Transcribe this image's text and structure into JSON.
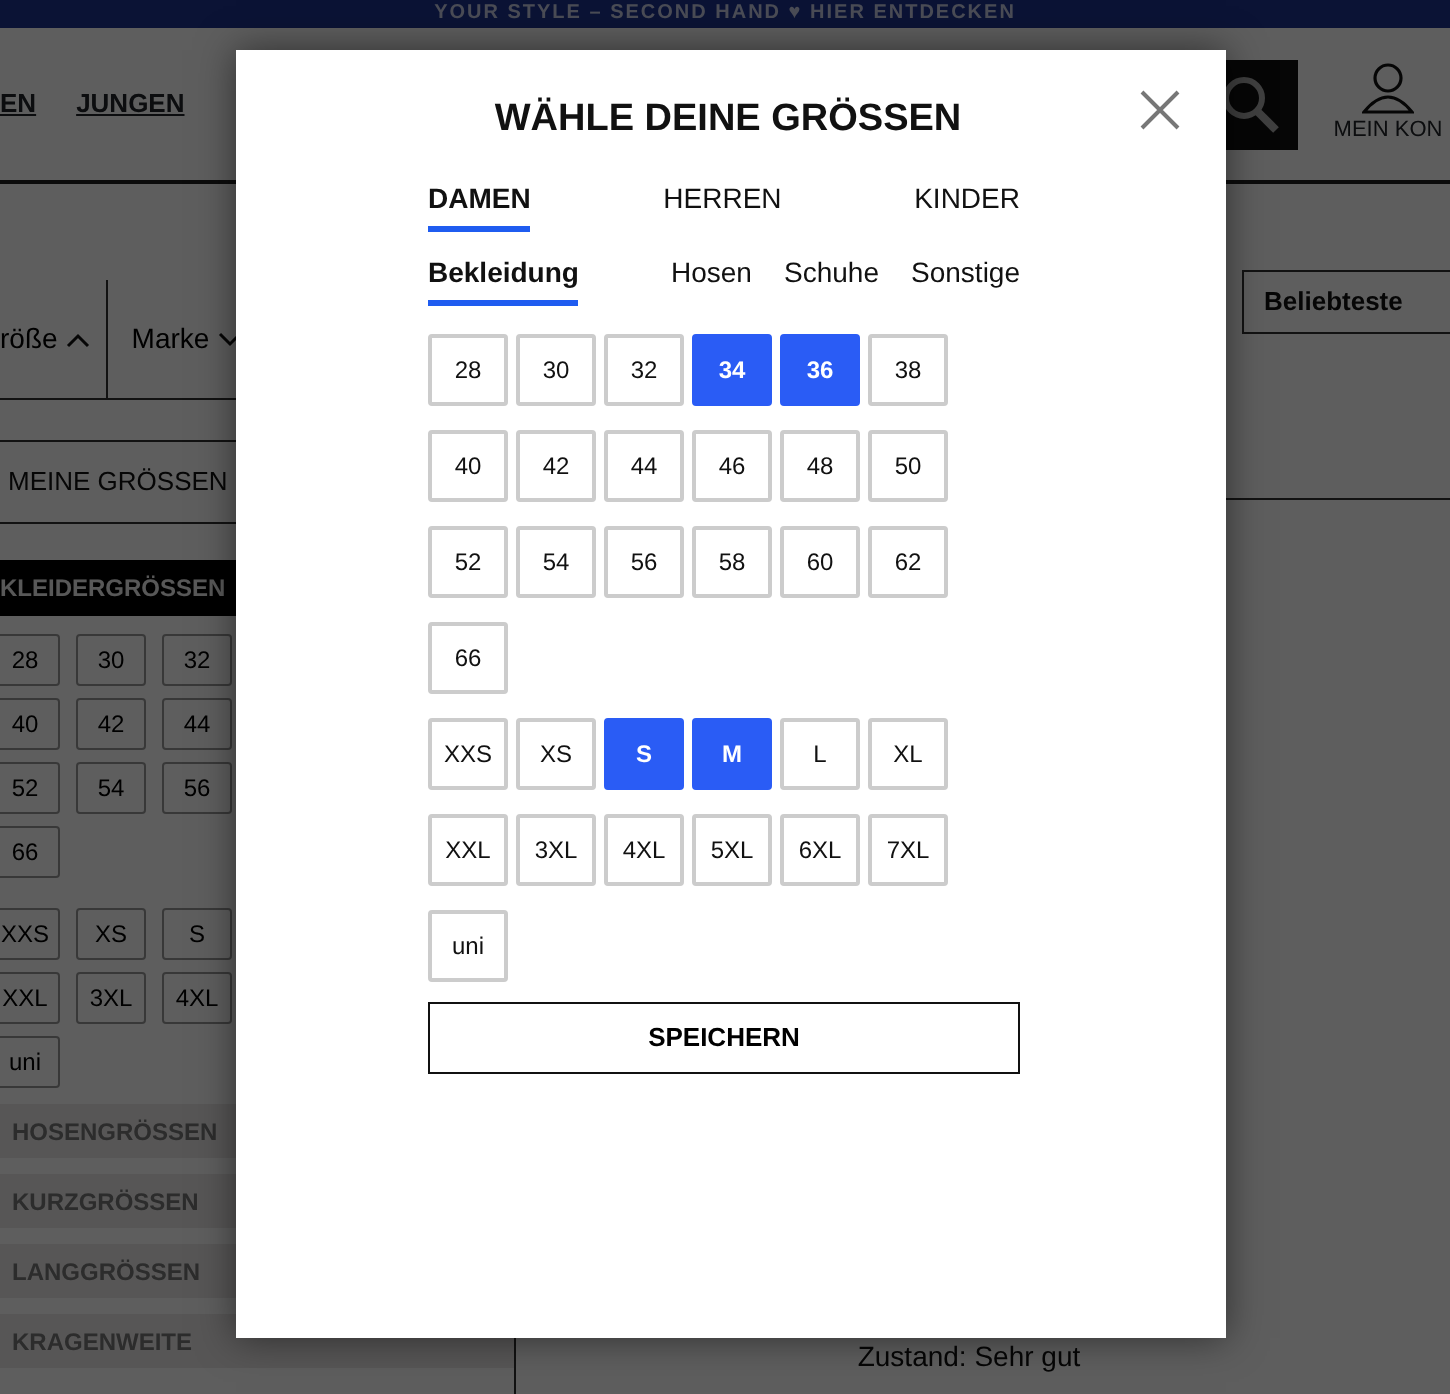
{
  "banner": {
    "text": "YOUR STYLE – SECOND HAND ♥ HIER ENTDECKEN"
  },
  "nav": [
    {
      "label": "EN"
    },
    {
      "label": "JUNGEN"
    }
  ],
  "account": {
    "label": "MEIN KON"
  },
  "filters": [
    {
      "label": "röße",
      "expanded": true
    },
    {
      "label": "Marke",
      "expanded": false
    }
  ],
  "sort": {
    "label": "Beliebteste"
  },
  "sidebar": {
    "title": "MEINE GRÖSSEN",
    "groups": [
      {
        "title": "KLEIDERGRÖSSEN",
        "expanded": true,
        "sizes": [
          [
            "28",
            "30",
            "32"
          ],
          [
            "40",
            "42",
            "44"
          ],
          [
            "52",
            "54",
            "56"
          ],
          [
            "66"
          ],
          [
            "XXS",
            "XS",
            "S"
          ],
          [
            "XXL",
            "3XL",
            "4XL"
          ],
          [
            "uni"
          ]
        ]
      },
      {
        "title": "HOSENGRÖSSEN",
        "expanded": false
      },
      {
        "title": "KURZGRÖSSEN",
        "expanded": false
      },
      {
        "title": "LANGGRÖSSEN",
        "expanded": false
      },
      {
        "title": "KRAGENWEITE",
        "expanded": false
      }
    ]
  },
  "product": {
    "lines": [
      "Zustand: Sehr gut"
    ]
  },
  "modal": {
    "title": "WÄHLE DEINE GRÖSSEN",
    "tabs": [
      {
        "label": "DAMEN",
        "selected": true
      },
      {
        "label": "HERREN",
        "selected": false
      },
      {
        "label": "KINDER",
        "selected": false
      }
    ],
    "subtabs": [
      {
        "label": "Bekleidung",
        "selected": true
      },
      {
        "label": "Hosen",
        "selected": false
      },
      {
        "label": "Schuhe",
        "selected": false
      },
      {
        "label": "Sonstige",
        "selected": false
      }
    ],
    "size_groups": [
      [
        {
          "label": "28",
          "selected": false
        },
        {
          "label": "30",
          "selected": false
        },
        {
          "label": "32",
          "selected": false
        },
        {
          "label": "34",
          "selected": true
        },
        {
          "label": "36",
          "selected": true
        },
        {
          "label": "38",
          "selected": false
        },
        {
          "label": "40",
          "selected": false
        },
        {
          "label": "42",
          "selected": false
        },
        {
          "label": "44",
          "selected": false
        },
        {
          "label": "46",
          "selected": false
        },
        {
          "label": "48",
          "selected": false
        },
        {
          "label": "50",
          "selected": false
        },
        {
          "label": "52",
          "selected": false
        },
        {
          "label": "54",
          "selected": false
        },
        {
          "label": "56",
          "selected": false
        },
        {
          "label": "58",
          "selected": false
        },
        {
          "label": "60",
          "selected": false
        },
        {
          "label": "62",
          "selected": false
        },
        {
          "label": "66",
          "selected": false
        }
      ],
      [
        {
          "label": "XXS",
          "selected": false
        },
        {
          "label": "XS",
          "selected": false
        },
        {
          "label": "S",
          "selected": true
        },
        {
          "label": "M",
          "selected": true
        },
        {
          "label": "L",
          "selected": false
        },
        {
          "label": "XL",
          "selected": false
        },
        {
          "label": "XXL",
          "selected": false
        },
        {
          "label": "3XL",
          "selected": false
        },
        {
          "label": "4XL",
          "selected": false
        },
        {
          "label": "5XL",
          "selected": false
        },
        {
          "label": "6XL",
          "selected": false
        },
        {
          "label": "7XL",
          "selected": false
        },
        {
          "label": "uni",
          "selected": false
        }
      ]
    ],
    "save_button": "SPEICHERN"
  }
}
